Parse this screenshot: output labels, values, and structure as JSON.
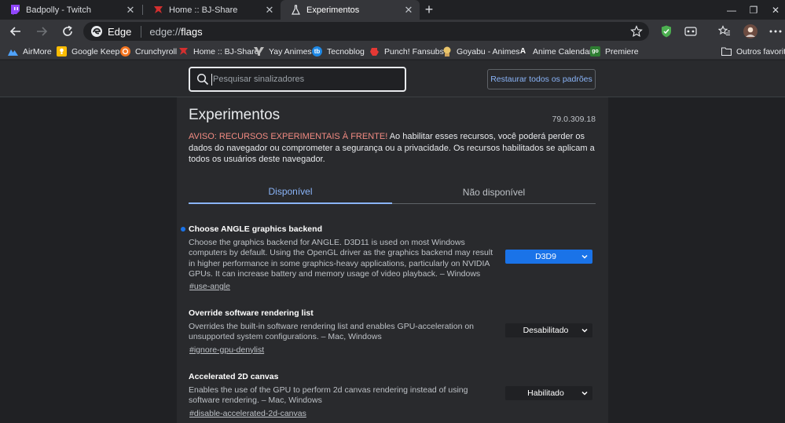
{
  "tabs": [
    {
      "title": "Badpolly - Twitch",
      "icon": "twitch-icon",
      "active": false
    },
    {
      "title": "Home :: BJ-Share",
      "icon": "bj-share-icon",
      "active": false
    },
    {
      "title": "Experimentos",
      "icon": "flask-icon",
      "active": true
    }
  ],
  "window_controls": {
    "minimize": "—",
    "restore": "❐",
    "close": "✕"
  },
  "omnibox": {
    "site_label": "Edge",
    "url_prefix": "edge://",
    "url_path": "flags"
  },
  "bookmarks": [
    {
      "label": "AirMore",
      "icon": "airmore-icon",
      "color": "#4fa3ff"
    },
    {
      "label": "Google Keep",
      "icon": "google-keep-icon",
      "color": "#fbbc04"
    },
    {
      "label": "Crunchyroll",
      "icon": "crunchyroll-icon",
      "color": "#f47521"
    },
    {
      "label": "Home :: BJ-Share",
      "icon": "bj-share-icon",
      "color": "#c62828"
    },
    {
      "label": "Yay Animes",
      "icon": "yay-animes-icon",
      "color": "#444"
    },
    {
      "label": "Tecnoblog",
      "icon": "tecnoblog-icon",
      "color": "#1e88e5"
    },
    {
      "label": "Punch! Fansubs",
      "icon": "punch-fansubs-icon",
      "color": "#e53935"
    },
    {
      "label": "Goyabu - Animes",
      "icon": "goyabu-icon",
      "color": "#cfa35a"
    },
    {
      "label": "Anime Calendar",
      "icon": "anime-calendar-icon",
      "color": "#ffffff"
    },
    {
      "label": "Premiere",
      "icon": "premiere-icon",
      "color": "#2e7d32"
    }
  ],
  "other_favorites": "Outros favoritos",
  "search": {
    "placeholder": "Pesquisar sinalizadores"
  },
  "reset_button": "Restaurar todos os padrões",
  "page": {
    "title": "Experimentos",
    "version": "79.0.309.18",
    "warning_bold": "AVISO: RECURSOS EXPERIMENTAIS À FRENTE!",
    "warning_text": " Ao habilitar esses recursos, você poderá perder os dados do navegador ou comprometer a segurança ou a privacidade. Os recursos habilitados se aplicam a todos os usuários deste navegador.",
    "tab_available": "Disponível",
    "tab_unavailable": "Não disponível"
  },
  "experiments": [
    {
      "name": "Choose ANGLE graphics backend",
      "description": "Choose the graphics backend for ANGLE. D3D11 is used on most Windows computers by default. Using the OpenGL driver as the graphics backend may result in higher performance in some graphics-heavy applications, particularly on NVIDIA GPUs. It can increase battery and memory usage of video playback. – Windows",
      "tag": "#use-angle",
      "value": "D3D9",
      "modified": true
    },
    {
      "name": "Override software rendering list",
      "description": "Overrides the built-in software rendering list and enables GPU-acceleration on unsupported system configurations. – Mac, Windows",
      "tag": "#ignore-gpu-denylist",
      "value": "Desabilitado",
      "modified": false
    },
    {
      "name": "Accelerated 2D canvas",
      "description": "Enables the use of the GPU to perform 2d canvas rendering instead of using software rendering. – Mac, Windows",
      "tag": "#disable-accelerated-2d-canvas",
      "value": "Habilitado",
      "modified": false
    }
  ],
  "colors": {
    "accent": "#8ab4f8",
    "warning": "#f28b82",
    "enabled_select": "#1a73e8"
  }
}
